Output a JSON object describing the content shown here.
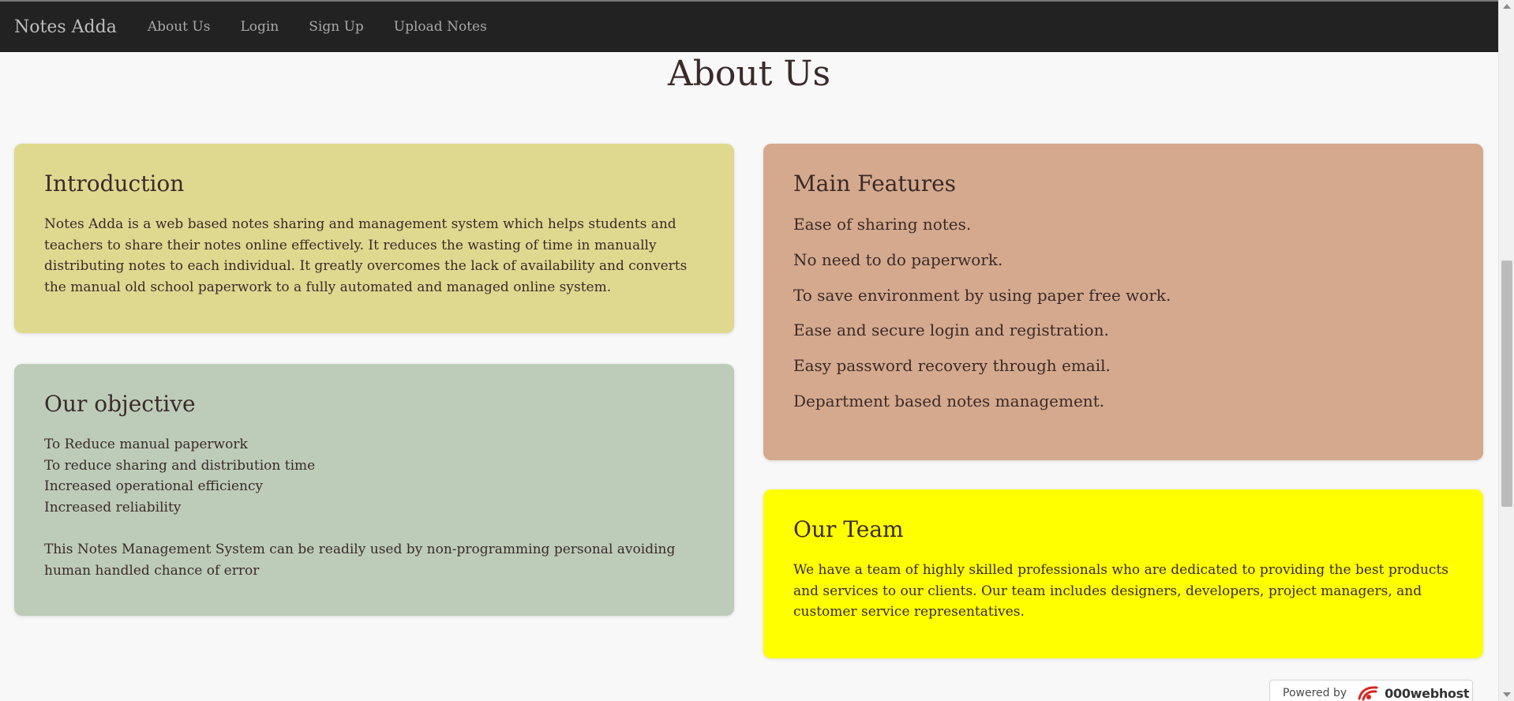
{
  "navbar": {
    "brand": "Notes Adda",
    "links": [
      "About Us",
      "Login",
      "Sign Up",
      "Upload Notes"
    ]
  },
  "page": {
    "title": "About Us"
  },
  "intro": {
    "heading": "Introduction",
    "text": "Notes Adda is a web based notes sharing and management system which helps students and teachers to share their notes online effectively. It reduces the wasting of time in manually distributing notes to each individual. It greatly overcomes the lack of availability and converts the manual old school paperwork to a fully automated and managed online system."
  },
  "objective": {
    "heading": "Our objective",
    "items": [
      "To Reduce manual paperwork",
      "To reduce sharing and distribution time",
      "Increased operational efficiency",
      "Increased reliability"
    ],
    "note": "This Notes Management System can be readily used by non-programming personal avoiding human handled chance of error"
  },
  "features": {
    "heading": "Main Features",
    "items": [
      "Ease of sharing notes.",
      "No need to do paperwork.",
      "To save environment by using paper free work.",
      "Ease and secure login and registration.",
      "Easy password recovery through email.",
      "Department based notes management."
    ]
  },
  "team": {
    "heading": "Our Team",
    "text": "We have a team of highly skilled professionals who are dedicated to providing the best products and services to our clients. Our team includes designers, developers, project managers, and customer service representatives."
  },
  "footer_badge": {
    "powered": "Powered by",
    "brand": "000webhost"
  },
  "colors": {
    "navbar": "#222222",
    "intro_card": "#dfd990",
    "objective_card": "#bdccb8",
    "features_card": "#d5a98d",
    "team_card": "#ffff00",
    "background": "#f8f8f8"
  }
}
